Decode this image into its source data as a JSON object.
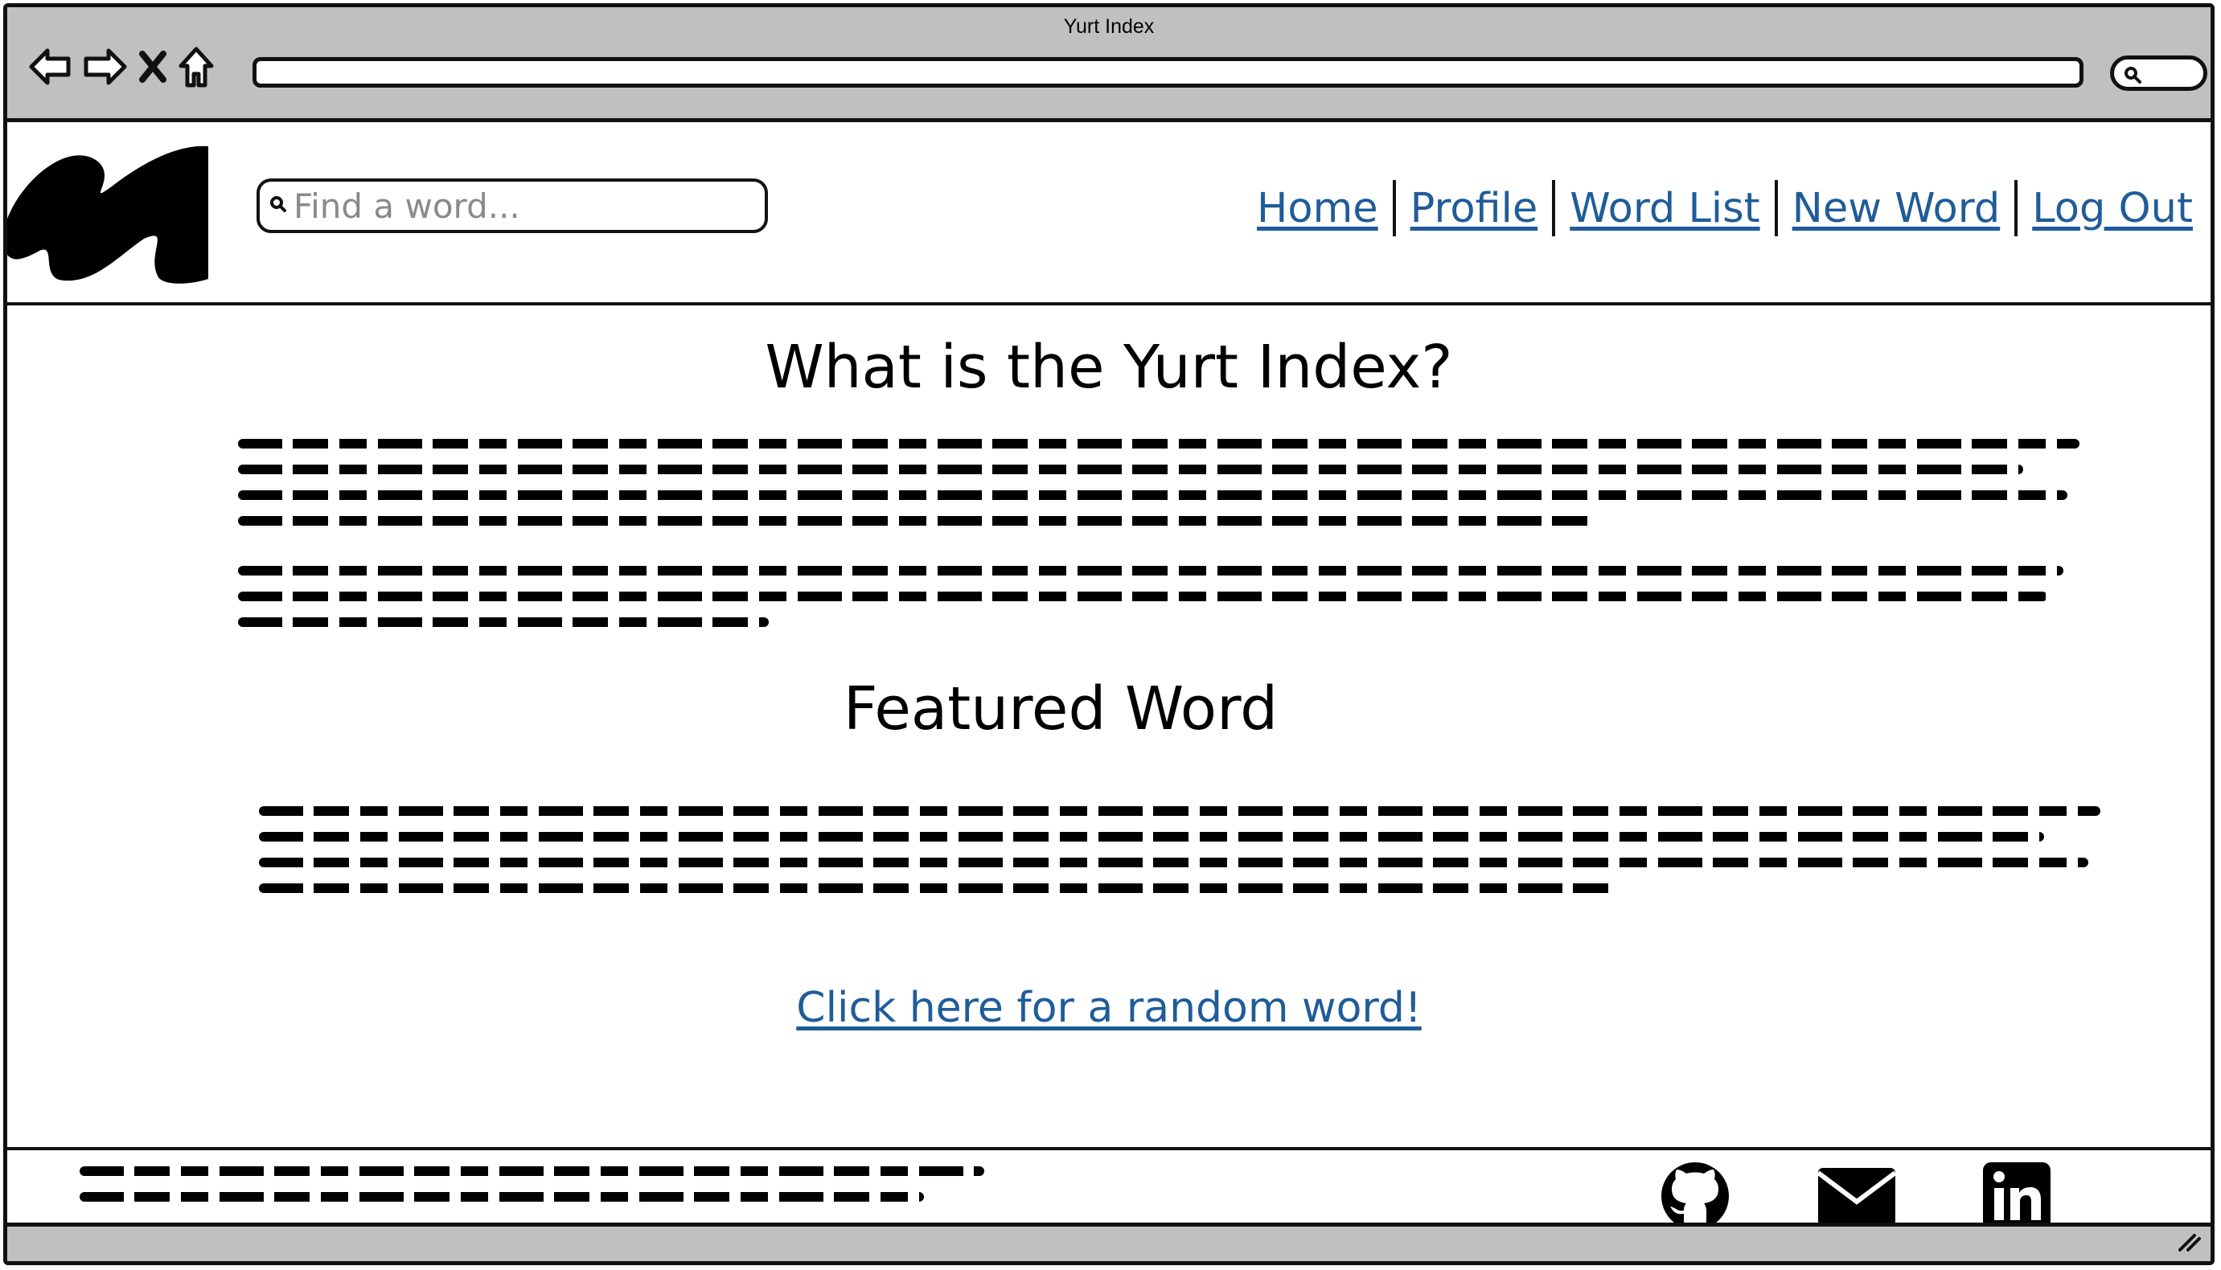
{
  "browser": {
    "window_title": "Yurt Index"
  },
  "header": {
    "search": {
      "placeholder": "Find a word..."
    },
    "nav": [
      "Home",
      "Profile",
      "Word List",
      "New Word",
      "Log Out"
    ]
  },
  "main": {
    "about_heading": "What is the Yurt Index?",
    "featured_heading": "Featured Word",
    "random_link": "Click here for a random word!"
  },
  "footer": {
    "social_icons": [
      "github-icon",
      "email-icon",
      "linkedin-icon"
    ]
  },
  "colors": {
    "chrome": "#c0c0c0",
    "link": "#1f5c99",
    "border": "#111111"
  }
}
